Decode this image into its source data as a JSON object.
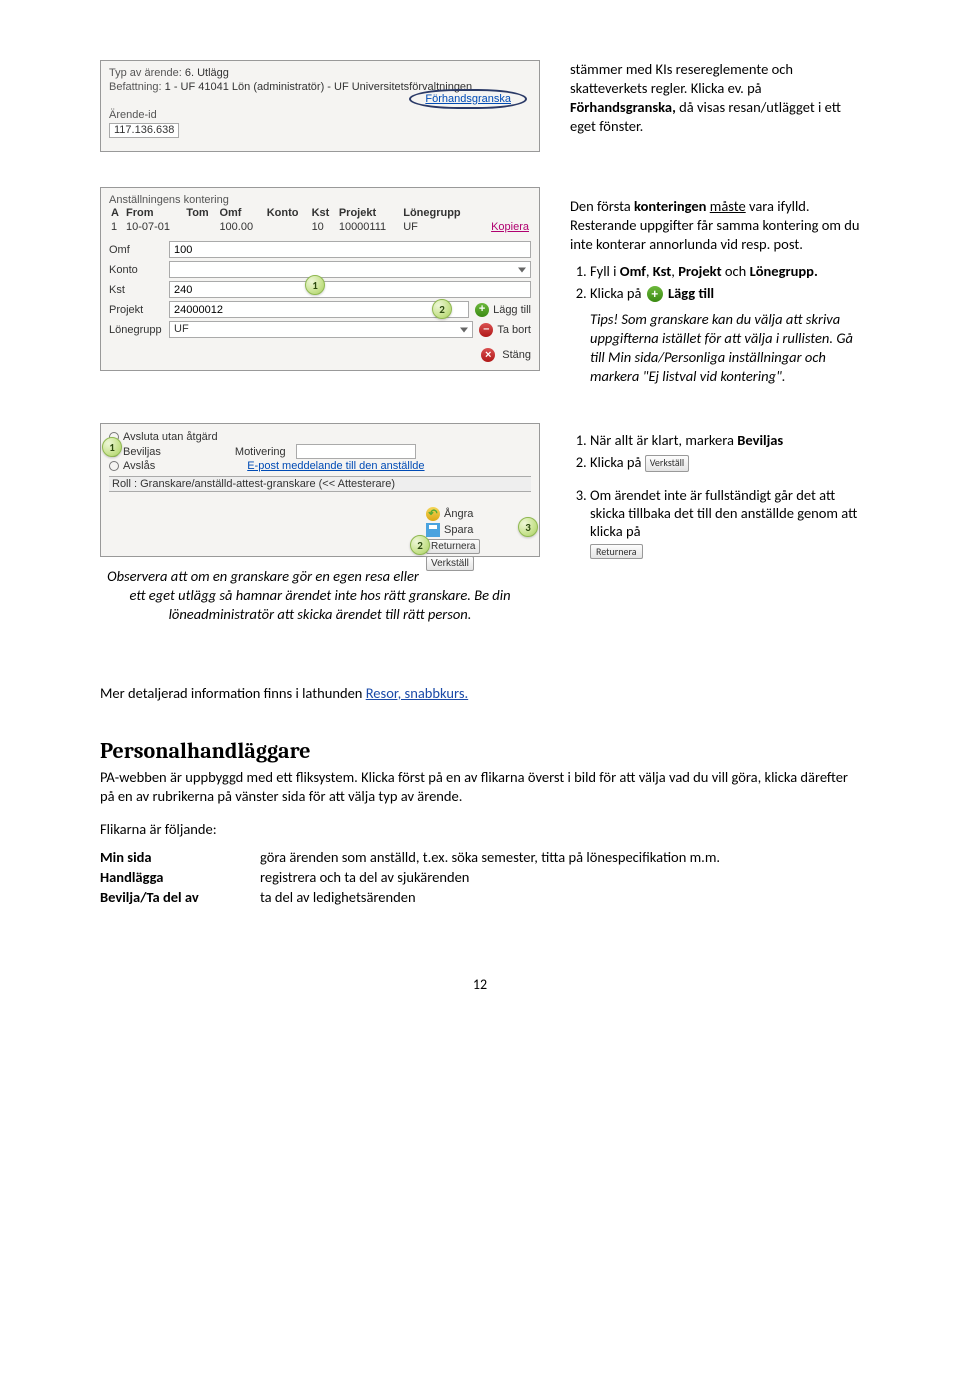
{
  "shot1": {
    "type_label": "Typ av ärende:",
    "type_value": "6. Utlägg",
    "befattning_label": "Befattning:",
    "befattning_value": "1 - UF 41041 Lön (administratör) - UF Universitetsförvaltningen",
    "forhandsgranska": "Förhandsgranska",
    "arende_label": "Ärende-id",
    "arende_value": "117.136.638"
  },
  "para1a": "stämmer med KIs resereglemente och skatteverkets regler. Klicka ev. på ",
  "para1b": "Förhandsgranska,",
  "para1c": " då visas resan/utlägget i ett eget fönster.",
  "shot2": {
    "title": "Anställningens kontering",
    "headers": [
      "A",
      "From",
      "Tom",
      "Omf",
      "Konto",
      "Kst",
      "Projekt",
      "Lönegrupp"
    ],
    "row": [
      "1",
      "10-07-01",
      "",
      "100.00",
      "",
      "10",
      "10000111",
      "UF"
    ],
    "kopiera": "Kopiera",
    "fields": {
      "omf": {
        "label": "Omf",
        "value": "100"
      },
      "konto": {
        "label": "Konto",
        "value": ""
      },
      "kst": {
        "label": "Kst",
        "value": "240"
      },
      "projekt": {
        "label": "Projekt",
        "value": "24000012"
      },
      "lonegrupp": {
        "label": "Lönegrupp",
        "value": "UF"
      }
    },
    "laggtill": "Lägg till",
    "tabort": "Ta bort",
    "stang": "Stäng"
  },
  "right2": {
    "intro1": "Den första ",
    "intro1b": "konteringen",
    "intro1c": " måste vara ifylld. Resterande uppgifter får samma kontering om du inte konterar annorlunda vid resp. post.",
    "li1a": "Fyll i ",
    "li1b": "Omf",
    "li1c": "Kst",
    "li1d": "Projekt",
    "li1e": " och ",
    "li1f": "Lönegrupp.",
    "li2a": "Klicka på ",
    "li2b": "Lägg till",
    "tips": "Tips! Som granskare kan du välja att skriva uppgifterna istället för att välja i rullisten. Gå till Min sida/Personliga inställningar och markera \"Ej listval vid kontering\"."
  },
  "shot3": {
    "r1": "Avsluta utan åtgärd",
    "r2": "Beviljas",
    "r3": "Avslås",
    "motivering": "Motivering",
    "epost": "E-post meddelande till den anställde",
    "role": "Roll : Granskare/anställd-attest-granskare (<< Attesterare)",
    "angra": "Ångra",
    "spara": "Spara",
    "returnera": "Returnera",
    "verkstall": "Verkställ"
  },
  "right3": {
    "li1a": "När allt är klart, markera ",
    "li1b": "Beviljas",
    "li2a": "Klicka på ",
    "li2b": "Verkställ",
    "li3a": "Om ärendet inte är full­ständigt går det att skicka tillbaka det till den anställde genom att klicka på",
    "li3b": "Returnera"
  },
  "observera": "Observera att om en granskare gör en egen resa eller ett eget utlägg så hamnar ärendet inte hos rätt granskare. Be din löneadministratör att skicka ärendet till rätt person.",
  "mer_info_a": "Mer detaljerad information finns i lathunden ",
  "mer_info_link": "Resor, snabbkurs.",
  "sec_heading": "Personalhandläggare",
  "sec_para": "PA-webben är uppbyggd med ett fliksystem. Klicka först på en av flikarna överst i bild för att välja vad du vill göra, klicka därefter på en av rubrikerna på vänster sida för att välja typ av ärende.",
  "flikar_label": "Flikarna är följande:",
  "defs": [
    {
      "term": "Min sida",
      "desc": "göra ärenden som anställd, t.ex. söka semester, titta på lönespecifikation m.m."
    },
    {
      "term": "Handlägga",
      "desc": "registrera och ta del av sjukärenden"
    },
    {
      "term": "Bevilja/Ta del av",
      "desc": "ta del av ledighetsärenden"
    }
  ],
  "page_number": "12",
  "callouts": {
    "one": "1",
    "two": "2",
    "three": "3"
  }
}
